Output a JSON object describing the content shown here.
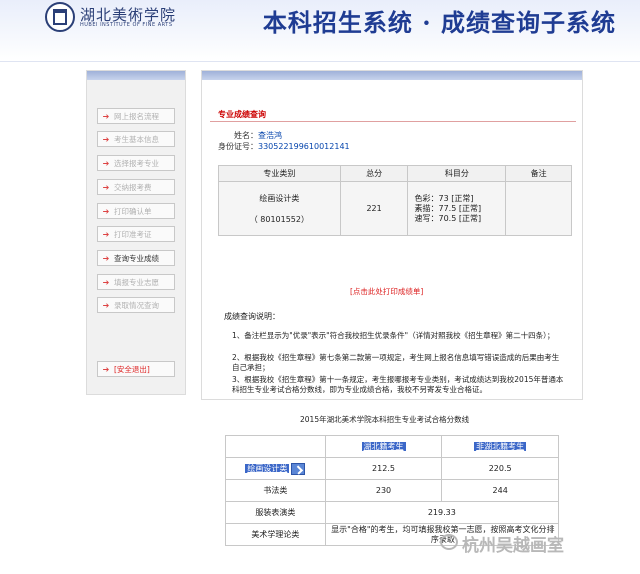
{
  "header": {
    "school_cn": "湖北美術学院",
    "school_en": "HUBEI INSTITUTE OF FINE ARTS",
    "system_title": "本科招生系统 · 成绩查询子系统"
  },
  "sidebar": {
    "items": [
      {
        "label": "网上报名流程"
      },
      {
        "label": "考生基本信息"
      },
      {
        "label": "选择报考专业"
      },
      {
        "label": "交纳报考费"
      },
      {
        "label": "打印确认单"
      },
      {
        "label": "打印准考证"
      },
      {
        "label": "查询专业成绩"
      },
      {
        "label": "填报专业志愿"
      },
      {
        "label": "录取情况查询"
      }
    ],
    "logout": "[安全退出]"
  },
  "main": {
    "section_title": "专业成绩查询",
    "name_label": "姓名：",
    "name_value": "查浩鸿",
    "id_label": "身份证号：",
    "id_value": "330522199610012141",
    "table": {
      "headers": [
        "专业类别",
        "总分",
        "科目分",
        "备注"
      ],
      "major": "绘画设计类",
      "code": "（ 80101552）",
      "total": "221",
      "subjects": [
        "色彩：73 [正常]",
        "素描：77.5 [正常]",
        "速写：70.5 [正常]"
      ],
      "remark": ""
    },
    "print_link": "[点击此处打印成绩单]",
    "notes_title": "成绩查询说明：",
    "notes": [
      "1、备注栏显示为\"优录\"表示\"符合我校招生优录条件\"（详情对照我校《招生章程》第二十四条）；",
      "2、根据我校《招生章程》第七条第二款第一项规定，考生网上报名信息填写错误造成的后果由考生自己承担；",
      "3、根据我校《招生章程》第十一条规定，考生报哪报考专业类别，考试成绩达到我校2015年普通本科招生专业考试合格分数线，即为专业成绩合格，我校不另寄发专业合格证。"
    ]
  },
  "bottom": {
    "title": "2015年湖北美术学院本科招生专业考试合格分数线",
    "col_headers": [
      "湖北籍考生",
      "非湖北籍考生"
    ],
    "rows": [
      {
        "label": "绘画设计类",
        "v1": "212.5",
        "v2": "220.5"
      },
      {
        "label": "书法类",
        "v1": "230",
        "v2": "244"
      },
      {
        "label": "服装表演类",
        "v": "219.33"
      },
      {
        "label": "美术学理论类",
        "v": "显示\"合格\"的考生，均可填报我校第一志愿，按照高考文化分排序录取"
      }
    ]
  },
  "watermark": "杭州吴越画室"
}
